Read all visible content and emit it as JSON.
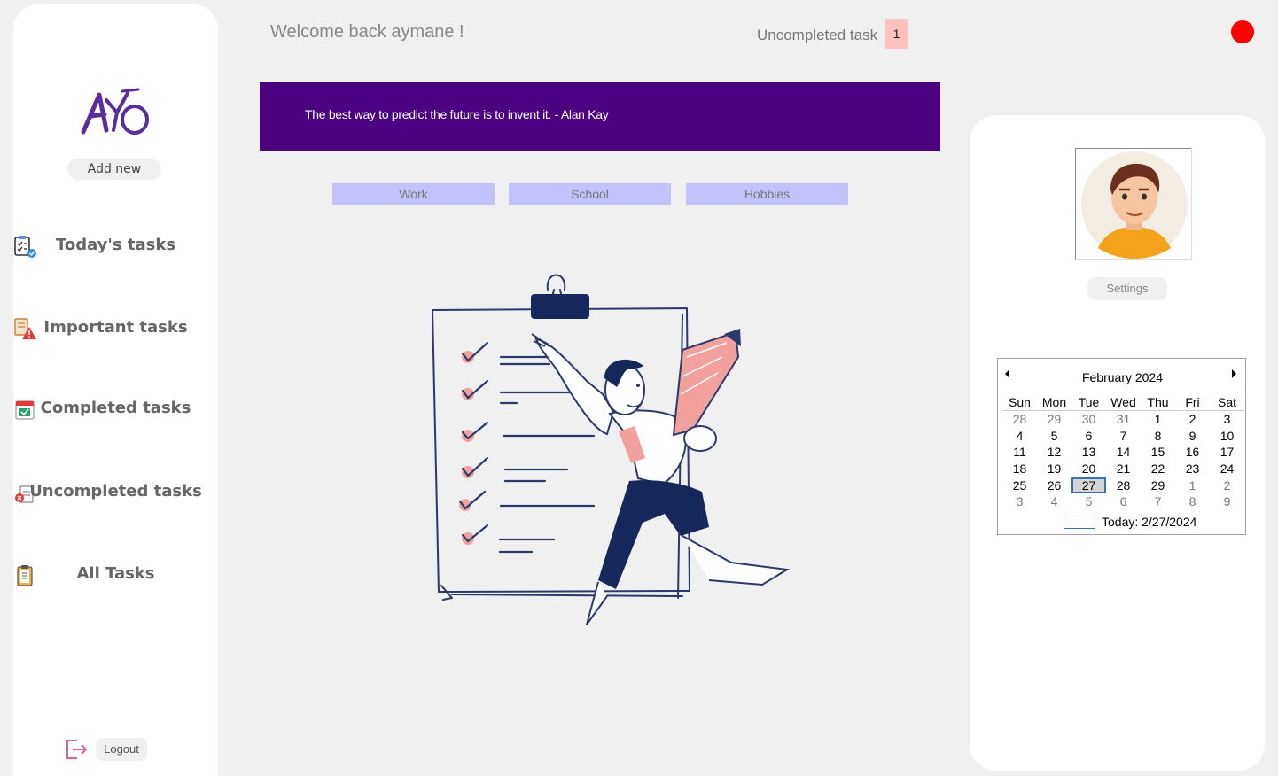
{
  "header": {
    "welcome": "Welcome back aymane !",
    "uncompleted_label": "Uncompleted task",
    "uncompleted_count": "1"
  },
  "quote": "The best way to predict the future is to invent it. - Alan Kay",
  "categories": [
    "Work",
    "School",
    "Hobbies"
  ],
  "sidebar": {
    "logo_text": "AY",
    "add_new": "Add new",
    "items": [
      {
        "label": "Today's tasks",
        "icon": "checklist-icon"
      },
      {
        "label": "Important tasks",
        "icon": "warning-document-icon"
      },
      {
        "label": "Completed tasks",
        "icon": "calendar-check-icon"
      },
      {
        "label": "Uncompleted tasks",
        "icon": "document-x-icon"
      },
      {
        "label": "All Tasks",
        "icon": "clipboard-icon"
      }
    ],
    "logout": "Logout"
  },
  "profile": {
    "settings": "Settings"
  },
  "calendar": {
    "title": "February 2024",
    "days": [
      "Sun",
      "Mon",
      "Tue",
      "Wed",
      "Thu",
      "Fri",
      "Sat"
    ],
    "weeks": [
      [
        "28",
        "29",
        "30",
        "31",
        "1",
        "2",
        "3"
      ],
      [
        "4",
        "5",
        "6",
        "7",
        "8",
        "9",
        "10"
      ],
      [
        "11",
        "12",
        "13",
        "14",
        "15",
        "16",
        "17"
      ],
      [
        "18",
        "19",
        "20",
        "21",
        "22",
        "23",
        "24"
      ],
      [
        "25",
        "26",
        "27",
        "28",
        "29",
        "1",
        "2"
      ],
      [
        "3",
        "4",
        "5",
        "6",
        "7",
        "8",
        "9"
      ]
    ],
    "selected": "27",
    "today": "Today: 2/27/2024"
  },
  "colors": {
    "banner": "#4b0082",
    "category": "#c2c2ff",
    "status_dot": "#ff0000",
    "count_badge": "#ffc0c0"
  }
}
